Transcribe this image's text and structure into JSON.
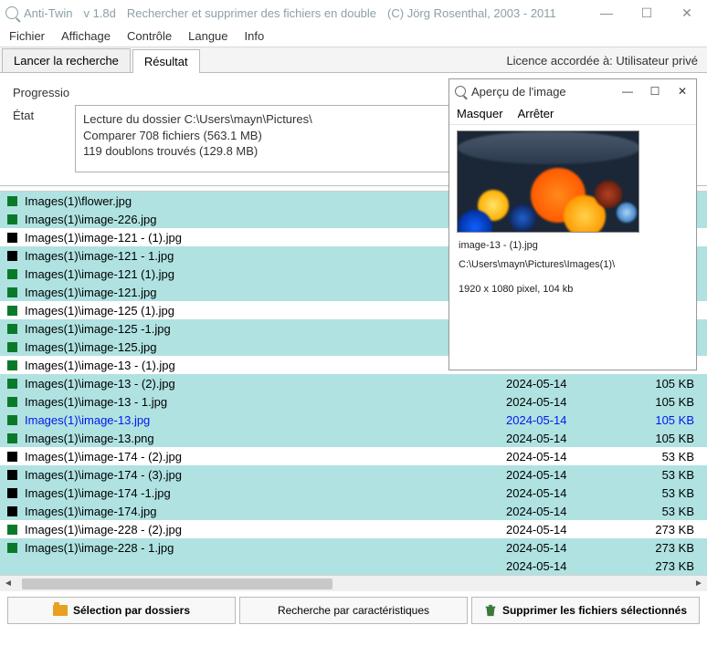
{
  "title": {
    "app": "Anti-Twin",
    "ver": "v 1.8d",
    "desc": "Rechercher et supprimer des fichiers en double",
    "copy": "(C) Jörg Rosenthal, 2003 - 2011"
  },
  "titlebtn": {
    "min": "—",
    "max": "☐",
    "close": "✕"
  },
  "menu": [
    "Fichier",
    "Affichage",
    "Contrôle",
    "Langue",
    "Info"
  ],
  "tabs": {
    "search": "Lancer la recherche",
    "result": "Résultat",
    "license": "Licence accordée à:  Utilisateur privé"
  },
  "prog": {
    "label1": "Progressio",
    "label2": "État",
    "lines": [
      "Lecture du dossier C:\\Users\\mayn\\Pictures\\",
      "Comparer 708 fichiers (563.1 MB)",
      "119 doublons trouvés (129.8 MB)"
    ]
  },
  "rows": [
    {
      "sq": "green",
      "path": "Images(1)\\flower.jpg",
      "date": "",
      "size": "",
      "group": true
    },
    {
      "sq": "green",
      "path": "Images(1)\\image-226.jpg",
      "date": "",
      "size": "",
      "group": true
    },
    {
      "sq": "black",
      "path": "Images(1)\\image-121 - (1).jpg",
      "date": "",
      "size": "",
      "group": false
    },
    {
      "sq": "black",
      "path": "Images(1)\\image-121 - 1.jpg",
      "date": "",
      "size": "",
      "group": true
    },
    {
      "sq": "green",
      "path": "Images(1)\\image-121 (1).jpg",
      "date": "",
      "size": "",
      "group": true
    },
    {
      "sq": "green",
      "path": "Images(1)\\image-121.jpg",
      "date": "",
      "size": "",
      "group": true
    },
    {
      "sq": "green",
      "path": "Images(1)\\image-125 (1).jpg",
      "date": "",
      "size": "",
      "group": false
    },
    {
      "sq": "green",
      "path": "Images(1)\\image-125 -1.jpg",
      "date": "",
      "size": "",
      "group": true
    },
    {
      "sq": "green",
      "path": "Images(1)\\image-125.jpg",
      "date": "",
      "size": "",
      "group": true
    },
    {
      "sq": "green",
      "path": "Images(1)\\image-13 - (1).jpg",
      "date": "",
      "size": "",
      "group": false
    },
    {
      "sq": "green",
      "path": "Images(1)\\image-13 - (2).jpg",
      "date": "2024-05-14",
      "size": "105 KB",
      "group": true
    },
    {
      "sq": "green",
      "path": "Images(1)\\image-13 - 1.jpg",
      "date": "2024-05-14",
      "size": "105 KB",
      "group": true
    },
    {
      "sq": "green",
      "path": "Images(1)\\image-13.jpg",
      "date": "2024-05-14",
      "size": "105 KB",
      "group": true,
      "hl": true
    },
    {
      "sq": "green",
      "path": "Images(1)\\image-13.png",
      "date": "2024-05-14",
      "size": "105 KB",
      "group": true
    },
    {
      "sq": "black",
      "path": "Images(1)\\image-174 - (2).jpg",
      "date": "2024-05-14",
      "size": "53 KB",
      "group": false
    },
    {
      "sq": "black",
      "path": "Images(1)\\image-174 - (3).jpg",
      "date": "2024-05-14",
      "size": "53 KB",
      "group": true
    },
    {
      "sq": "black",
      "path": "Images(1)\\image-174 -1.jpg",
      "date": "2024-05-14",
      "size": "53 KB",
      "group": true
    },
    {
      "sq": "black",
      "path": "Images(1)\\image-174.jpg",
      "date": "2024-05-14",
      "size": "53 KB",
      "group": true
    },
    {
      "sq": "green",
      "path": "Images(1)\\image-228 - (2).jpg",
      "date": "2024-05-14",
      "size": "273 KB",
      "group": false
    },
    {
      "sq": "green",
      "path": "Images(1)\\image-228 - 1.jpg",
      "date": "2024-05-14",
      "size": "273 KB",
      "group": true
    },
    {
      "sq": "",
      "path": "",
      "date": "2024-05-14",
      "size": "273 KB",
      "group": true
    }
  ],
  "buttons": {
    "byfolder": "Sélection par dossiers",
    "bychar": "Recherche par caractéristiques",
    "delete": "Supprimer les fichiers sélectionnés"
  },
  "preview": {
    "title": "Aperçu de l'image",
    "menu": {
      "hide": "Masquer",
      "stop": "Arrêter"
    },
    "file": "image-13 - (1).jpg",
    "dir": "C:\\Users\\mayn\\Pictures\\Images(1)\\",
    "meta": "1920 x 1080 pixel, 104 kb"
  }
}
